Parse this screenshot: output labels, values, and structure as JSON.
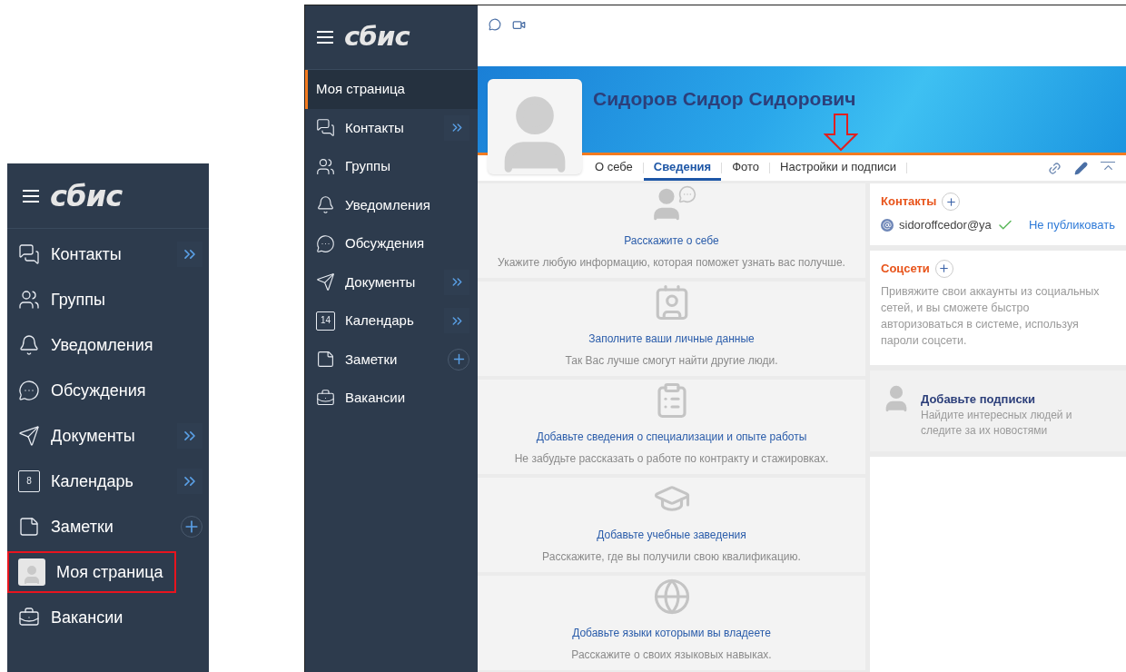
{
  "left_panel": {
    "logo": "сбис",
    "items": [
      {
        "label": "Контакты",
        "kind": "contacts",
        "expandable": true,
        "addable": false,
        "highlighted": false
      },
      {
        "label": "Группы",
        "kind": "groups",
        "expandable": false,
        "addable": false,
        "highlighted": false
      },
      {
        "label": "Уведомления",
        "kind": "bell",
        "expandable": false,
        "addable": false,
        "highlighted": false
      },
      {
        "label": "Обсуждения",
        "kind": "chat",
        "expandable": false,
        "addable": false,
        "highlighted": false
      },
      {
        "label": "Документы",
        "kind": "send",
        "expandable": true,
        "addable": false,
        "highlighted": false
      },
      {
        "label": "Календарь",
        "kind": "calendar",
        "calendar_day": "8",
        "expandable": true,
        "addable": false,
        "highlighted": false
      },
      {
        "label": "Заметки",
        "kind": "note",
        "expandable": false,
        "addable": true,
        "highlighted": false
      },
      {
        "label": "Моя страница",
        "kind": "avatar",
        "expandable": false,
        "addable": false,
        "highlighted": true
      },
      {
        "label": "Вакансии",
        "kind": "vacancy",
        "expandable": false,
        "addable": false,
        "highlighted": false
      }
    ]
  },
  "app": {
    "sidebar": {
      "logo": "сбис",
      "items": [
        {
          "label": "Моя страница",
          "kind": "page",
          "expandable": false,
          "addable": false,
          "selected": true
        },
        {
          "label": "Контакты",
          "kind": "contacts",
          "expandable": true,
          "addable": false,
          "selected": false
        },
        {
          "label": "Группы",
          "kind": "groups",
          "expandable": false,
          "addable": false,
          "selected": false
        },
        {
          "label": "Уведомления",
          "kind": "bell",
          "expandable": false,
          "addable": false,
          "selected": false
        },
        {
          "label": "Обсуждения",
          "kind": "chat",
          "expandable": false,
          "addable": false,
          "selected": false
        },
        {
          "label": "Документы",
          "kind": "send",
          "expandable": true,
          "addable": false,
          "selected": false
        },
        {
          "label": "Календарь",
          "kind": "calendar",
          "calendar_day": "14",
          "expandable": true,
          "addable": false,
          "selected": false
        },
        {
          "label": "Заметки",
          "kind": "note",
          "expandable": false,
          "addable": true,
          "selected": false
        },
        {
          "label": "Вакансии",
          "kind": "vacancy",
          "expandable": false,
          "addable": false,
          "selected": false
        }
      ]
    },
    "profile": {
      "name": "Сидоров Сидор Сидорович",
      "tabs": [
        {
          "label": "О себе",
          "selected": false
        },
        {
          "label": "Сведения",
          "selected": true
        },
        {
          "label": "Фото",
          "selected": false
        },
        {
          "label": "Настройки и подписи",
          "selected": false
        }
      ]
    },
    "cards": [
      {
        "kind": "person-chat",
        "title": "Расскажите о себе",
        "text": "Укажите любую информацию, которая поможет узнать вас получше."
      },
      {
        "kind": "id-card",
        "title": "Заполните ваши личные данные",
        "text": "Так Вас лучше смогут найти другие люди."
      },
      {
        "kind": "resume",
        "title": "Добавьте сведения о специализации и опыте работы",
        "text": "Не забудьте рассказать о работе по контракту и стажировках."
      },
      {
        "kind": "books",
        "title": "Добавьте учебные заведения",
        "text": "Расскажите, где вы получили свою квалификацию."
      },
      {
        "kind": "globe",
        "title": "Добавьте языки которыми вы владеете",
        "text": "Расскажите о своих языковых навыках."
      }
    ],
    "contacts": {
      "title": "Контакты",
      "email": "sidoroffcedor@ya",
      "verified": true,
      "publish_link": "Не публиковать"
    },
    "social": {
      "title": "Соцсети",
      "text": "Привяжите свои аккаунты из социальных сетей, и вы сможете быстро авторизоваться в системе, используя пароли соцсети."
    },
    "subscriptions": {
      "title": "Добавьте подписки",
      "text": "Найдите интересных людей и следите за их новостями"
    }
  }
}
